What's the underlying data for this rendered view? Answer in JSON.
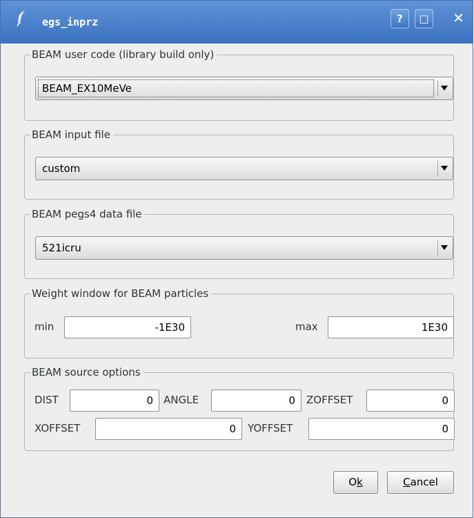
{
  "window": {
    "title": "egs_inprz",
    "help_button": "?",
    "maximize_button": "□",
    "close_button": "✕"
  },
  "user_code": {
    "legend": "BEAM user code (library build only)",
    "selected": "BEAM_EX10MeVe"
  },
  "input_file": {
    "legend": "BEAM input file",
    "selected": "custom"
  },
  "pegs_file": {
    "legend": "BEAM pegs4 data file",
    "selected": "521icru"
  },
  "weight_window": {
    "legend": "Weight window for BEAM particles",
    "min_label": "min",
    "min_value": "-1E30",
    "max_label": "max",
    "max_value": "1E30"
  },
  "source_options": {
    "legend": "BEAM source options",
    "dist_label": "DIST",
    "dist_value": "0",
    "angle_label": "ANGLE",
    "angle_value": "0",
    "zoffset_label": "ZOFFSET",
    "zoffset_value": "0",
    "xoffset_label": "XOFFSET",
    "xoffset_value": "0",
    "yoffset_label": "YOFFSET",
    "yoffset_value": "0"
  },
  "buttons": {
    "ok_mnemonic_prefix": "O",
    "ok_mnemonic": "k",
    "cancel_mnemonic": "C",
    "cancel_rest": "ancel"
  }
}
